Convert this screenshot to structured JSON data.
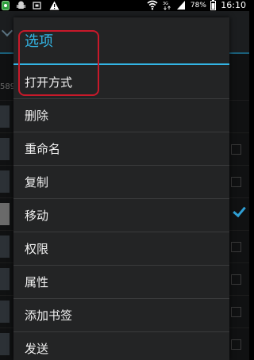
{
  "status_bar": {
    "left_icons": [
      "app-notification-icon",
      "android-debug-icon",
      "screenshot-icon",
      "warning-icon"
    ],
    "right_icons": [
      "wifi-icon",
      "network-3g-icon",
      "signal-icon"
    ],
    "battery": "78%",
    "time": "16:10"
  },
  "background": {
    "path_fragment": "589"
  },
  "dialog": {
    "title": "选项",
    "items": [
      {
        "label": "打开方式"
      },
      {
        "label": "删除"
      },
      {
        "label": "重命名"
      },
      {
        "label": "复制"
      },
      {
        "label": "移动"
      },
      {
        "label": "权限"
      },
      {
        "label": "属性"
      },
      {
        "label": "添加书签"
      },
      {
        "label": "发送"
      }
    ]
  },
  "colors": {
    "accent": "#33b5e5",
    "annotation": "#c8192a",
    "dialog_bg": "#232425"
  }
}
